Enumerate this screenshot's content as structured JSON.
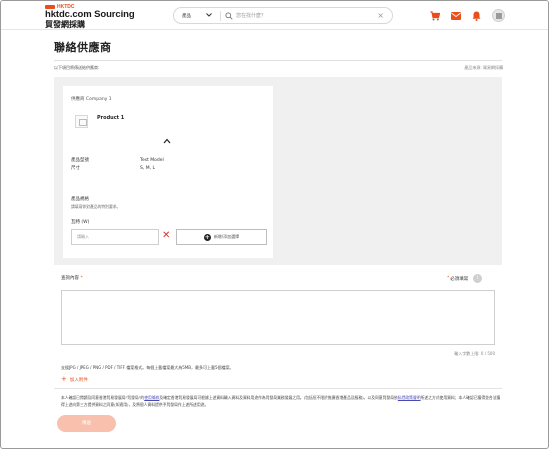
{
  "header": {
    "logo_badge": "HKTDC",
    "logo_main": "hktdc.com Sourcing",
    "logo_sub": "貿發網採購",
    "search_scope": "產品",
    "search_placeholder": "您在找什麼？",
    "icons": [
      "cart-icon",
      "mail-icon",
      "bell-icon",
      "menu-icon"
    ],
    "accent_color": "#e94e1b"
  },
  "page": {
    "title": "聯絡供應商",
    "intro": "以下項目將傳送給供應商:",
    "source_note": "產品來源: 貿易網採購"
  },
  "card": {
    "supplier": "供應商 Company 1",
    "product_name": "Product 1",
    "spec_labels": [
      "產品型號",
      "尺寸"
    ],
    "spec_values": [
      "Test Model",
      "S, M, L"
    ],
    "spec_title": "產品規格",
    "spec_sub": "請填寫你對產品的特別要求。",
    "qty_label": "瓦特 (W)",
    "qty_placeholder": "請輸入",
    "add_option_label": "新增/添加選擇"
  },
  "inquiry": {
    "label": "查詢內容",
    "template_label": "必須填寫",
    "counter": "輸入字數上限: 0 / 500",
    "file_note": "支援JPG / JPEG / PNG / PDF / TIFF 檔案格式。每個上載檔案最大為5MB，最多可上載5個檔案。",
    "attach_label": "加入附件"
  },
  "legal": {
    "part1": "本人確認已閱讀及同意香港貿易發展局\"貿發局\"的",
    "link1": "使用條款",
    "part2": "及確定香港貿易發展局可根據上述資料輸入資料及資料用途作為貿發局業務發展之用。(包括但不限於推廣香港產品及服務)。以及同意貿發局依",
    "link2": "私隱政策聲明",
    "part3": "所述之方式使用資料；本人確認已獲得並合法獲得上述向第三方提供資料之同意(如適用)，及將個人資料提供予貿發局作上述所述用途。",
    "send_label": "傳送"
  }
}
